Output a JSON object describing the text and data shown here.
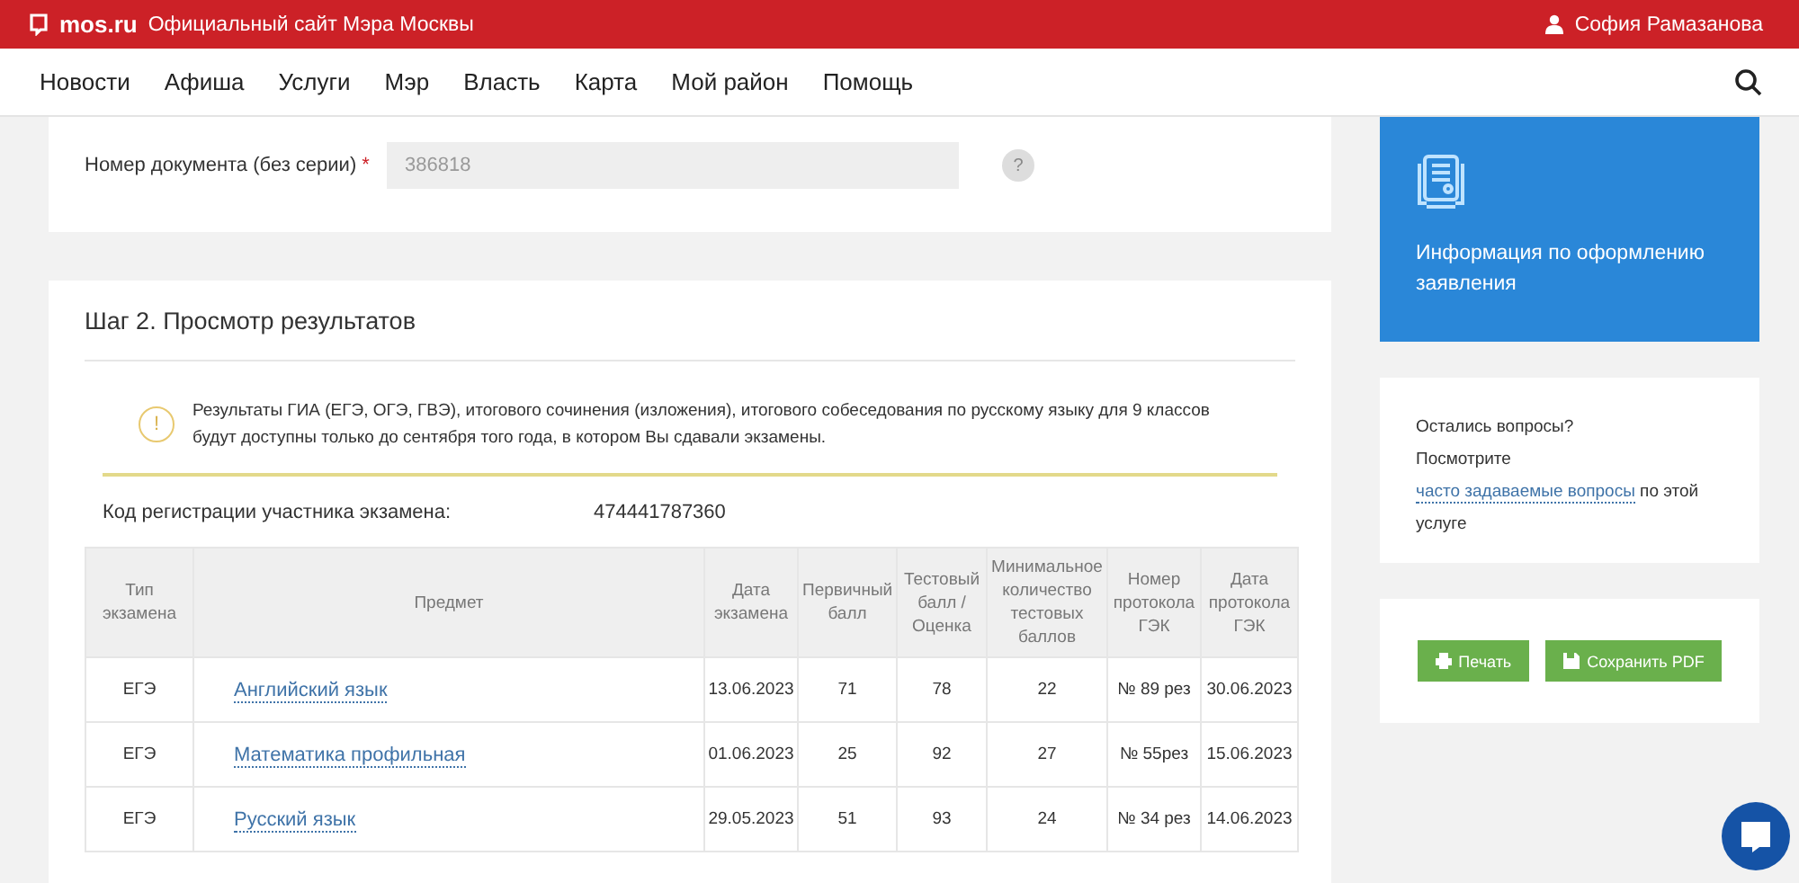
{
  "topbar": {
    "logo": "mos.ru",
    "site_title": "Официальный сайт Мэра Москвы",
    "user": "София Рамазанова"
  },
  "nav": [
    "Новости",
    "Афиша",
    "Услуги",
    "Мэр",
    "Власть",
    "Карта",
    "Мой район",
    "Помощь"
  ],
  "document_field": {
    "label": "Номер документа (без серии)",
    "required_mark": "*",
    "value": "386818",
    "help": "?"
  },
  "step": {
    "title": "Шаг 2. Просмотр результатов",
    "notice": "Результаты ГИА (ЕГЭ, ОГЭ, ГВЭ), итогового сочинения (изложения), итогового собеседования по русскому языку для 9 классов будут доступны только до сентября того года, в котором Вы сдавали экзамены.",
    "notice_icon": "!",
    "registration_label": "Код регистрации участника экзамена:",
    "registration_code": "474441787360",
    "table": {
      "columns": [
        "Тип экзамена",
        "Предмет",
        "Дата экзамена",
        "Первичный балл",
        "Тестовый балл / Оценка",
        "Минимальное количество тестовых баллов",
        "Номер протокола ГЭК",
        "Дата протокола ГЭК"
      ],
      "rows": [
        [
          "ЕГЭ",
          "Английский язык",
          "13.06.2023",
          "71",
          "78",
          "22",
          "№ 89 рез",
          "30.06.2023"
        ],
        [
          "ЕГЭ",
          "Математика профильная",
          "01.06.2023",
          "25",
          "92",
          "27",
          "№ 55рез",
          "15.06.2023"
        ],
        [
          "ЕГЭ",
          "Русский язык",
          "29.05.2023",
          "51",
          "93",
          "24",
          "№ 34 рез",
          "14.06.2023"
        ]
      ]
    }
  },
  "info_card": {
    "title": "Информация по оформлению заявления"
  },
  "questions": {
    "title": "Остались вопросы?",
    "before": "Посмотрите",
    "link": "часто задаваемые вопросы",
    "after": "по этой услуге"
  },
  "actions": [
    {
      "kind": "print",
      "label": "Печать"
    },
    {
      "kind": "pdf",
      "label": "Сохранить PDF"
    }
  ]
}
